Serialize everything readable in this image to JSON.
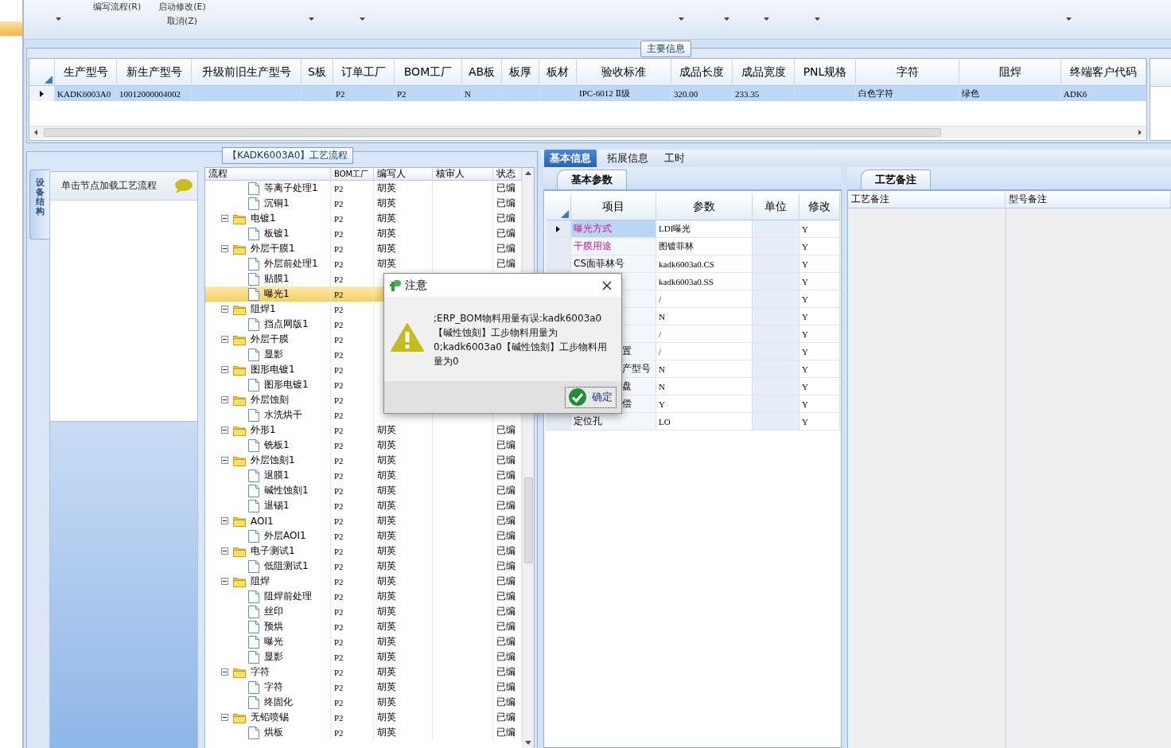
{
  "toolbar": {
    "items": [
      {
        "label": "编写流程(R)"
      },
      {
        "label": "启动修改(E)"
      },
      {
        "label": "取消(Z)"
      }
    ]
  },
  "main_info": {
    "title": "主要信息",
    "row": {
      "selected": true
    },
    "columns": [
      {
        "label": "生产型号",
        "value": "KADK6003A0"
      },
      {
        "label": "新生产型号",
        "value": "10012000004002"
      },
      {
        "label": "升级前旧生产型号"
      },
      {
        "label": "S板"
      },
      {
        "label": "订单工厂",
        "value": "P2"
      },
      {
        "label": "BOM工厂",
        "value": "P2"
      },
      {
        "label": "AB板",
        "value": "N"
      },
      {
        "label": "板厚"
      },
      {
        "label": "板材"
      },
      {
        "label": "验收标准",
        "value": "IPC-6012 Ⅱ级"
      },
      {
        "label": "成品长度",
        "value": "320.00"
      },
      {
        "label": "成品宽度",
        "value": "233.35"
      },
      {
        "label": "PNL规格"
      },
      {
        "label": "字符",
        "value": "白色字符"
      },
      {
        "label": "阻焊",
        "value": "绿色"
      },
      {
        "label": "终端客户代码",
        "value": "ADK6"
      }
    ]
  },
  "process": {
    "title": "【KADK6003A0】工艺流程",
    "side_tab": "设备结构",
    "hint": "单击节点加载工艺流程",
    "columns": [
      "流程",
      "BOM工厂",
      "编写人",
      "核审人",
      "状态"
    ],
    "nodes": [
      {
        "kind": "continuation",
        "children": [
          {
            "label": "等离子处理1",
            "kind": "file",
            "selected": false,
            "factory": "P2",
            "editor": "胡英",
            "status": "已编"
          },
          {
            "label": "沉铜1",
            "kind": "file",
            "selected": false,
            "factory": "P2",
            "editor": "胡英",
            "status": "已编"
          }
        ]
      },
      {
        "label": "电镀1",
        "kind": "folder",
        "expanded": true,
        "selected": false,
        "factory": "P2",
        "editor": "胡英",
        "status": "已编",
        "children": [
          {
            "label": "板镀1",
            "kind": "file",
            "selected": false,
            "factory": "P2",
            "editor": "胡英",
            "status": "已编"
          }
        ]
      },
      {
        "label": "外层干膜1",
        "kind": "folder",
        "expanded": true,
        "selected": false,
        "factory": "P2",
        "editor": "胡英",
        "status": "已编",
        "children": [
          {
            "label": "外层前处理1",
            "kind": "file",
            "selected": false,
            "factory": "P2",
            "editor": "胡英",
            "status": "已编"
          },
          {
            "label": "贴膜1",
            "kind": "file",
            "selected": false,
            "factory": "P2"
          },
          {
            "label": "曝光1",
            "kind": "file",
            "selected": true,
            "factory": "P2"
          }
        ]
      },
      {
        "label": "阻焊1",
        "kind": "folder",
        "expanded": true,
        "selected": false,
        "factory": "P2",
        "children": [
          {
            "label": "挡点网版1",
            "kind": "file",
            "selected": false,
            "factory": "P2"
          }
        ]
      },
      {
        "label": "外层干膜",
        "kind": "folder",
        "expanded": true,
        "selected": false,
        "factory": "P2",
        "children": [
          {
            "label": "显影",
            "kind": "file",
            "selected": false,
            "factory": "P2"
          }
        ]
      },
      {
        "label": "图形电镀1",
        "kind": "folder",
        "expanded": true,
        "selected": false,
        "factory": "P2",
        "children": [
          {
            "label": "图形电镀1",
            "kind": "file",
            "selected": false,
            "factory": "P2"
          }
        ]
      },
      {
        "label": "外层蚀刻",
        "kind": "folder",
        "expanded": true,
        "selected": false,
        "factory": "P2",
        "children": [
          {
            "label": "水洗烘干",
            "kind": "file",
            "selected": false,
            "factory": "P2"
          }
        ]
      },
      {
        "label": "外形1",
        "kind": "folder",
        "expanded": true,
        "selected": false,
        "factory": "P2",
        "editor": "胡英",
        "status": "已编",
        "children": [
          {
            "label": "铣板1",
            "kind": "file",
            "selected": false,
            "factory": "P2",
            "editor": "胡英",
            "status": "已编"
          }
        ]
      },
      {
        "label": "外层蚀刻1",
        "kind": "folder",
        "expanded": true,
        "selected": false,
        "factory": "P2",
        "editor": "胡英",
        "status": "已编",
        "children": [
          {
            "label": "退膜1",
            "kind": "file",
            "selected": false,
            "factory": "P2",
            "editor": "胡英",
            "status": "已编"
          },
          {
            "label": "碱性蚀刻1",
            "kind": "file",
            "selected": false,
            "factory": "P2",
            "editor": "胡英",
            "status": "已编"
          },
          {
            "label": "退锡1",
            "kind": "file",
            "selected": false,
            "factory": "P2",
            "editor": "胡英",
            "status": "已编"
          }
        ]
      },
      {
        "label": "AOI1",
        "kind": "folder",
        "expanded": true,
        "selected": false,
        "factory": "P2",
        "editor": "胡英",
        "status": "已编",
        "children": [
          {
            "label": "外层AOI1",
            "kind": "file",
            "selected": false,
            "factory": "P2",
            "editor": "胡英",
            "status": "已编"
          }
        ]
      },
      {
        "label": "电子测试1",
        "kind": "folder",
        "expanded": true,
        "selected": false,
        "factory": "P2",
        "editor": "胡英",
        "status": "已编",
        "children": [
          {
            "label": "低阻测试1",
            "kind": "file",
            "selected": false,
            "factory": "P2",
            "editor": "胡英",
            "status": "已编"
          }
        ]
      },
      {
        "label": "阻焊",
        "kind": "folder",
        "expanded": true,
        "selected": false,
        "factory": "P2",
        "editor": "胡英",
        "status": "已编",
        "children": [
          {
            "label": "阻焊前处理",
            "kind": "file",
            "selected": false,
            "factory": "P2",
            "editor": "胡英",
            "status": "已编"
          },
          {
            "label": "丝印",
            "kind": "file",
            "selected": false,
            "factory": "P2",
            "editor": "胡英",
            "status": "已编"
          },
          {
            "label": "预烘",
            "kind": "file",
            "selected": false,
            "factory": "P2",
            "editor": "胡英",
            "status": "已编"
          },
          {
            "label": "曝光",
            "kind": "file",
            "selected": false,
            "factory": "P2",
            "editor": "胡英",
            "status": "已编"
          },
          {
            "label": "显影",
            "kind": "file",
            "selected": false,
            "factory": "P2",
            "editor": "胡英",
            "status": "已编"
          }
        ]
      },
      {
        "label": "字符",
        "kind": "folder",
        "expanded": true,
        "selected": false,
        "factory": "P2",
        "editor": "胡英",
        "status": "已编",
        "children": [
          {
            "label": "字符",
            "kind": "file",
            "selected": false,
            "factory": "P2",
            "editor": "胡英",
            "status": "已编"
          },
          {
            "label": "终固化",
            "kind": "file",
            "selected": false,
            "factory": "P2",
            "editor": "胡英",
            "status": "已编"
          }
        ]
      },
      {
        "label": "无铅喷锡",
        "kind": "folder",
        "expanded": true,
        "selected": false,
        "factory": "P2",
        "editor": "胡英",
        "status": "已编",
        "children": [
          {
            "label": "烘板",
            "kind": "file",
            "selected": false,
            "factory": "P2",
            "editor": "胡英",
            "status": "已编"
          }
        ]
      }
    ]
  },
  "detail": {
    "tabs": [
      {
        "label": "基本信息",
        "selected": true
      },
      {
        "label": "拓展信息",
        "selected": false
      },
      {
        "label": "工时",
        "selected": false
      }
    ],
    "params": {
      "tab": "基本参数",
      "columns": [
        "项目",
        "参数",
        "单位",
        "修改"
      ],
      "rows": [
        {
          "kind": "plain",
          "item": "曝光方式",
          "value": "LDI曝光",
          "modify": "Y",
          "required": true,
          "selected": true
        },
        {
          "kind": "plain",
          "item": "干膜用途",
          "value": "图镀菲林",
          "modify": "Y",
          "required": true,
          "selected": false
        },
        {
          "kind": "plain",
          "item": "CS面菲林号",
          "value": "kadk6003a0.CS",
          "modify": "Y",
          "required": false,
          "selected": false
        },
        {
          "kind": "plain",
          "value": "kadk6003a0.SS",
          "modify": "Y",
          "selected": false
        },
        {
          "kind": "plain",
          "value": "/",
          "modify": "Y",
          "selected": false
        },
        {
          "kind": "plain",
          "value": "N",
          "modify": "Y",
          "selected": false
        },
        {
          "kind": "plain",
          "value": "/",
          "modify": "Y",
          "selected": false
        },
        {
          "kind": "clipped",
          "item": "置",
          "value": "/",
          "modify": "Y",
          "required": false,
          "selected": false
        },
        {
          "kind": "clipped",
          "item": "产型号",
          "value": "N",
          "modify": "Y",
          "required": false,
          "selected": false
        },
        {
          "kind": "clipped",
          "item": "盘",
          "value": "N",
          "modify": "Y",
          "required": false,
          "selected": false
        },
        {
          "kind": "clipped",
          "item": "偿",
          "value": "Y",
          "modify": "Y",
          "required": false,
          "selected": false
        },
        {
          "kind": "plain",
          "item": "定位孔",
          "value": "LO",
          "modify": "Y",
          "required": false,
          "selected": false
        }
      ]
    },
    "notes": {
      "tab": "工艺备注",
      "columns": [
        "工艺备注",
        "型号备注"
      ]
    }
  },
  "dialog": {
    "title": "注意",
    "message": ";ERP_BOM物料用量有误:kadk6003a0【碱性蚀刻】工步物料用量为0;kadk6003a0【碱性蚀刻】工步物料用量为0",
    "button": "确定"
  }
}
